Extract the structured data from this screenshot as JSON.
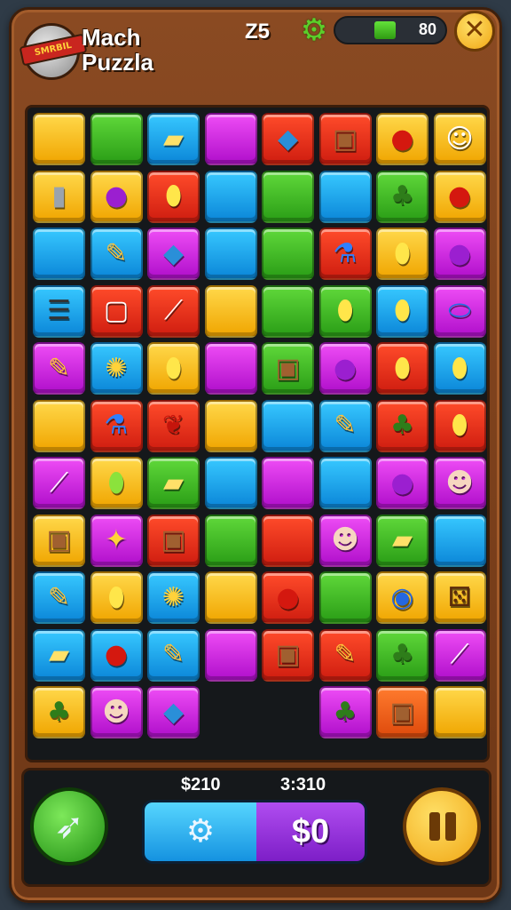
{
  "header": {
    "logo_text": "SMRBIL",
    "title_line1": "Mach",
    "title_line2": "Puzzla",
    "level": "Z5",
    "gear_icon": "gear-icon",
    "progress": {
      "fraction": 0.2,
      "value": "80"
    },
    "close_icon": "close-icon"
  },
  "board": {
    "cols": 8,
    "rows": 11,
    "tiles": [
      [
        "yellow:",
        "green:",
        "blue:butter",
        "purple:",
        "red:box",
        "red:crate",
        "yellow:apple",
        "yellow:face"
      ],
      [
        "yellow:can",
        "yellow:berry",
        "red:lemon",
        "blue:",
        "green:",
        "blue:",
        "green:tree",
        "yellow:apple"
      ],
      [
        "blue:",
        "blue:pencil",
        "purple:box",
        "blue:",
        "green:",
        "red:flask",
        "yellow:lemon",
        "purple:berry"
      ],
      [
        "blue:cob",
        "red:box-open",
        "red:knife",
        "yellow:",
        "green:",
        "green:lemon",
        "blue:lemon",
        "purple:balloon"
      ],
      [
        "purple:pencil",
        "blue:fire",
        "yellow:lemon",
        "purple:",
        "green:crate",
        "purple:berry",
        "red:lemon",
        "blue:lemon"
      ],
      [
        "yellow:",
        "red:flask",
        "red:cherry",
        "yellow:",
        "blue:",
        "blue:pencil",
        "red:tree",
        "red:lemon"
      ],
      [
        "purple:knife",
        "yellow:lime",
        "green:butter",
        "blue:",
        "purple:",
        "blue:",
        "purple:berry",
        "purple:face2"
      ],
      [
        "yellow:crate",
        "purple:crate2",
        "red:crate",
        "green:",
        "red:",
        "purple:face2",
        "green:butter",
        "blue:"
      ],
      [
        "blue:pencil",
        "yellow:lemon",
        "blue:fire",
        "yellow:",
        "red:apple",
        "green:",
        "yellow:button",
        "yellow:dice"
      ],
      [
        "blue:butter",
        "blue:apple",
        "blue:pencil",
        "purple:",
        "red:crate",
        "red:pencil",
        "green:tree",
        "purple:knife"
      ],
      [
        "yellow:tree",
        "purple:face2",
        "purple:box",
        "empty:",
        "empty:",
        "purple:tree",
        "orange:crate",
        "yellow:"
      ]
    ]
  },
  "bottom": {
    "compass_icon": "compass-icon",
    "money_label": "$210",
    "time_label": "3:310",
    "settings_icon": "gear-icon",
    "score": "$0",
    "pause_icon": "pause-icon"
  },
  "colors": {
    "frame": "#8a4a22",
    "board": "#15181b",
    "accent_yellow": "#f0a614",
    "accent_green": "#2a9d16"
  }
}
